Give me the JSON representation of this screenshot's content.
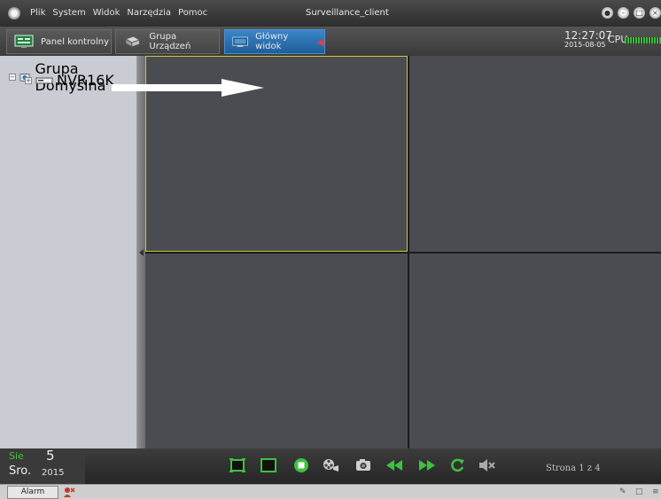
{
  "titlebar": {
    "menu": [
      "Plik",
      "System",
      "Widok",
      "Narzędzia",
      "Pomoc"
    ],
    "title": "Surveillance_client",
    "window_buttons": [
      "lock-icon",
      "minimize-icon",
      "restore-icon",
      "close-icon"
    ]
  },
  "tabs": [
    {
      "label": "Panel kontrolny",
      "icon": "control-panel-icon",
      "active": false
    },
    {
      "label": "Grupa Urządzeń",
      "icon": "device-group-icon",
      "active": false
    },
    {
      "label": "Główny widok",
      "icon": "monitor-icon",
      "active": true
    }
  ],
  "status": {
    "time": "12:27:07",
    "date": "2015-08-05",
    "cpu_label": "CPU"
  },
  "tree": {
    "root": "Grupa Domyślna",
    "child": "NVR16K"
  },
  "date_panel": {
    "month": "Sie",
    "day": "5",
    "weekday": "Sro.",
    "year": "2015"
  },
  "toolbar": {
    "icons": [
      "single-view-icon",
      "fullscreen-icon",
      "stop-all-icon",
      "record-icon",
      "snapshot-icon",
      "previous-page-icon",
      "next-page-icon",
      "refresh-icon",
      "mute-icon"
    ],
    "page_info": "Strona 1 z 4"
  },
  "statusbar": {
    "alarm_label": "Alarm"
  },
  "colors": {
    "accent_tab": "#2a6fb0",
    "selected_cell_border": "#c8c832",
    "video_cell": "#4b4b52",
    "tree_panel": "#c9ccd3",
    "cpu_bars": "#3ec23e"
  }
}
